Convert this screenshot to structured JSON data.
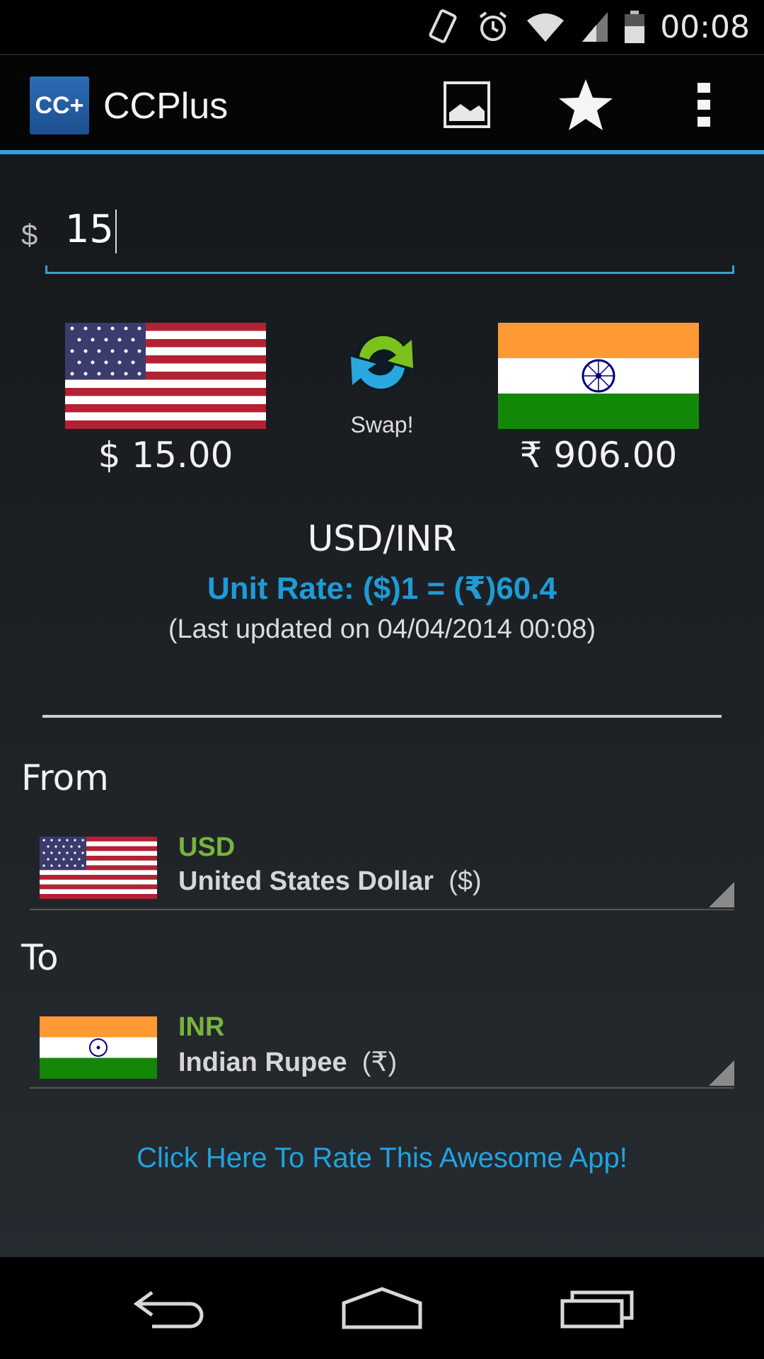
{
  "status_bar": {
    "time": "00:08",
    "icons": [
      "vibrate-icon",
      "alarm-icon",
      "wifi-icon",
      "signal-icon",
      "battery-icon"
    ]
  },
  "action_bar": {
    "logo_text": "CC+",
    "title": "CCPlus",
    "actions": [
      "image-icon",
      "star-icon",
      "overflow-menu-icon"
    ]
  },
  "amount": {
    "symbol": "$",
    "value": "15"
  },
  "conversion": {
    "from_value": "$ 15.00",
    "to_value": "₹ 906.00",
    "swap_label": "Swap!",
    "pair": "USD/INR",
    "unit_rate": "Unit Rate: ($)1 = (₹)60.4",
    "last_updated": "(Last updated on 04/04/2014 00:08)"
  },
  "from": {
    "label": "From",
    "code": "USD",
    "name": "United States Dollar",
    "symbol": "($)"
  },
  "to": {
    "label": "To",
    "code": "INR",
    "name": "Indian Rupee",
    "symbol": "(₹)"
  },
  "rate_link": "Click Here To Rate This Awesome App!",
  "colors": {
    "accent": "#33a3d6",
    "rate_text": "#1e9bd7",
    "currency_code": "#78b43d"
  }
}
